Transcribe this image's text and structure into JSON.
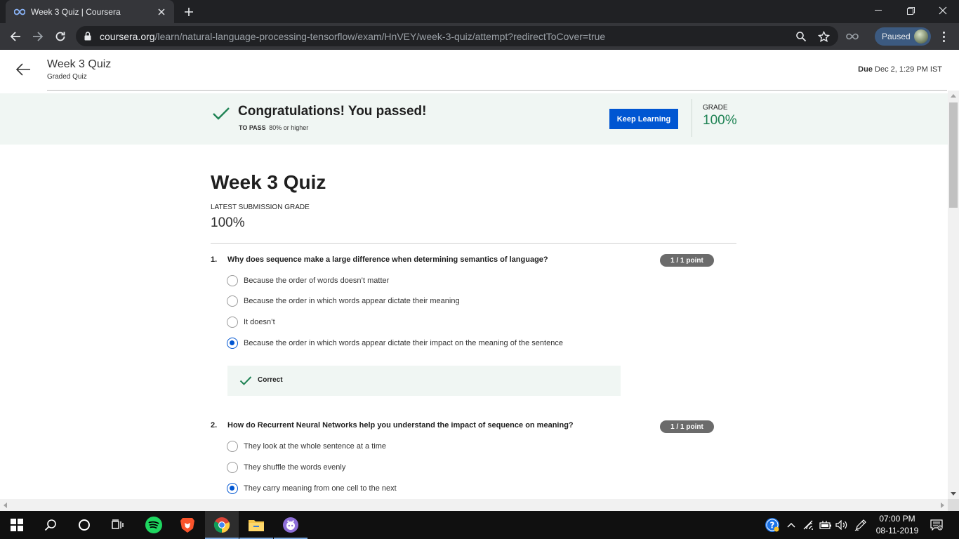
{
  "browser": {
    "tab_title": "Week 3 Quiz | Coursera",
    "url_host": "coursera.org",
    "url_path": "/learn/natural-language-processing-tensorflow/exam/HnVEY/week-3-quiz/attempt?redirectToCover=true",
    "profile_status": "Paused"
  },
  "header": {
    "title": "Week 3 Quiz",
    "subtitle": "Graded Quiz",
    "due_label": "Due",
    "due_value": "Dec 2, 1:29 PM IST"
  },
  "banner": {
    "title": "Congratulations! You passed!",
    "to_pass_label": "TO PASS",
    "to_pass_value": "80% or higher",
    "button_label": "Keep Learning",
    "grade_label": "GRADE",
    "grade_value": "100%"
  },
  "quiz": {
    "title": "Week 3 Quiz",
    "latest_label": "LATEST SUBMISSION GRADE",
    "latest_value": "100%",
    "questions": [
      {
        "number": "1.",
        "text": "Why does sequence make a large difference when determining semantics of language?",
        "points": "1 / 1 point",
        "options": [
          "Because the order of words doesn’t matter",
          "Because the order in which words appear dictate their meaning",
          "It doesn’t",
          "Because the order in which words appear dictate their impact on the meaning of the sentence"
        ],
        "selected_index": 3,
        "feedback": "Correct"
      },
      {
        "number": "2.",
        "text": "How do Recurrent Neural Networks help you understand the impact of sequence on meaning?",
        "points": "1 / 1 point",
        "options": [
          "They look at the whole sentence at a time",
          "They shuffle the words evenly",
          "They carry meaning from one cell to the next"
        ],
        "selected_index": 2
      }
    ]
  },
  "taskbar": {
    "time": "07:00 PM",
    "date": "08-11-2019"
  },
  "colors": {
    "primary_blue": "#0056d2",
    "success_green": "#1f8354",
    "banner_bg": "#f0f6f3"
  }
}
